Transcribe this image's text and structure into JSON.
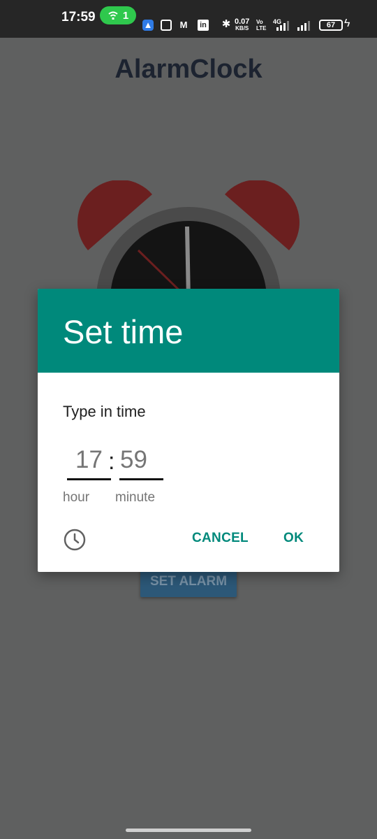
{
  "status_bar": {
    "time": "17:59",
    "hotspot_count": "1",
    "net_speed_value": "0.07",
    "net_speed_unit": "KB/S",
    "volte_label_1": "Vo",
    "volte_label_2": "LTE",
    "network_type": "4G",
    "battery": "67",
    "icons": [
      "hotspot-icon",
      "app-icon",
      "app-icon",
      "gmail-icon",
      "linkedin-icon",
      "bluetooth-icon",
      "signal-icon",
      "battery-icon",
      "charging-icon"
    ]
  },
  "app": {
    "title": "AlarmClock",
    "set_alarm_label": "SET ALARM"
  },
  "dialog": {
    "title": "Set time",
    "subtitle": "Type in time",
    "hour_value": "17",
    "minute_value": "59",
    "separator": ":",
    "hour_label": "hour",
    "minute_label": "minute",
    "cancel_label": "CANCEL",
    "ok_label": "OK",
    "mode_icon": "clock-icon"
  },
  "colors": {
    "accent": "#00897b",
    "scrim_background": "#5f6060",
    "status_bar": "#262626",
    "alarm_bell": "#6b1f1f",
    "set_alarm_button": "#2c5878"
  }
}
